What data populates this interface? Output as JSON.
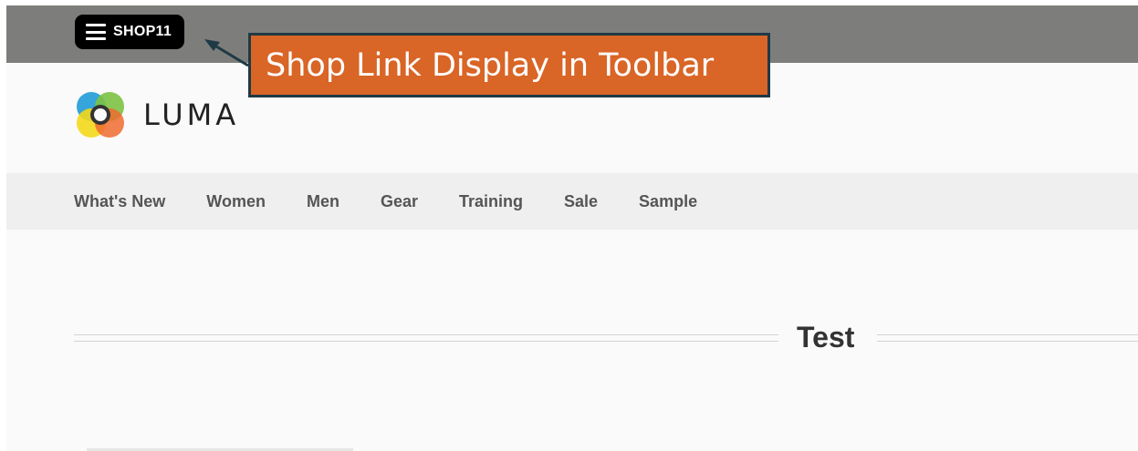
{
  "toolbar": {
    "shop_label": "SHOP11"
  },
  "brand": {
    "logo_text": "LUMA"
  },
  "nav": {
    "items": [
      "What's New",
      "Women",
      "Men",
      "Gear",
      "Training",
      "Sale",
      "Sample"
    ]
  },
  "content": {
    "section_title": "Test"
  },
  "annotation": {
    "callout_text": "Shop Link Display in Toolbar"
  },
  "colors": {
    "topbar": "#7d7e7b",
    "callout_bg": "#d96526",
    "callout_border": "#1f3a46",
    "nav_bg": "#efefef"
  }
}
